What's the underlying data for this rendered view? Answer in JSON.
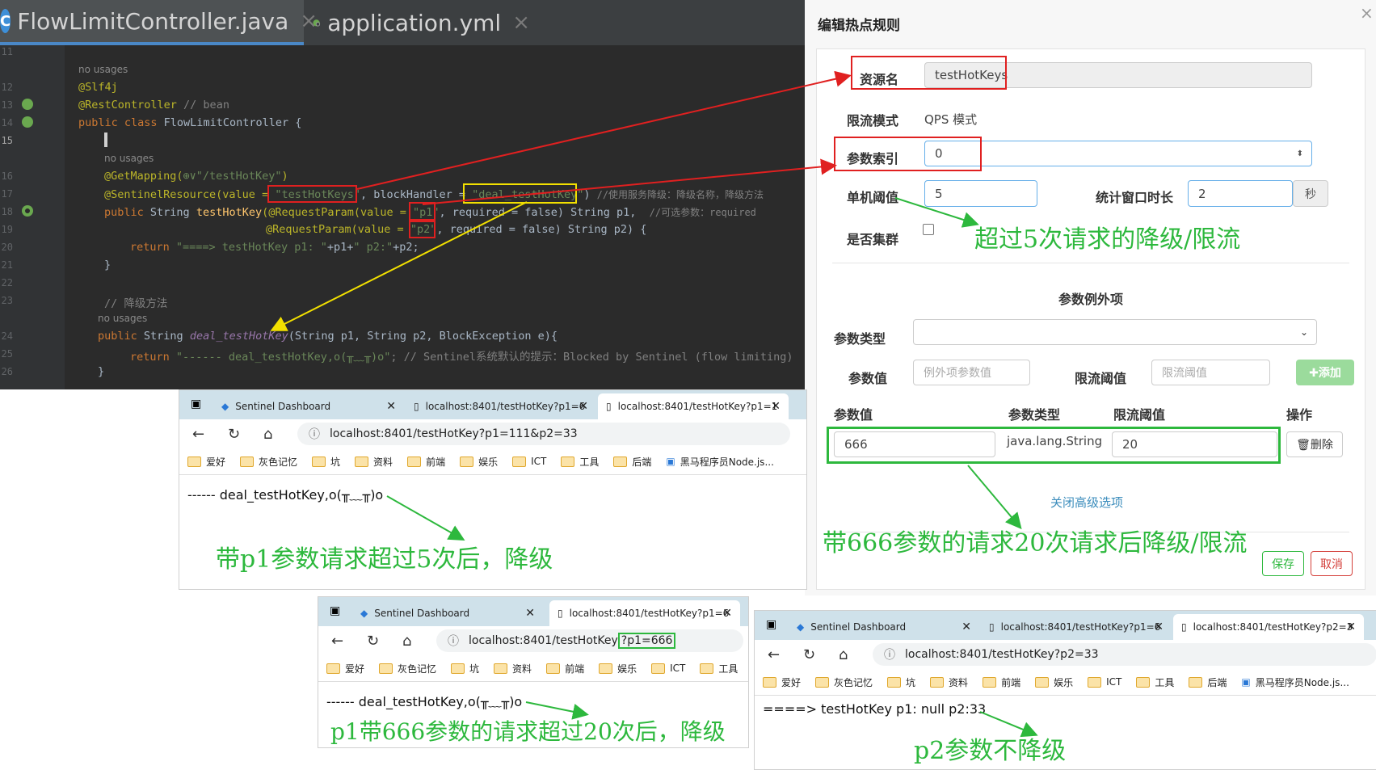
{
  "ide": {
    "tabs": [
      {
        "label": "FlowLimitController.java",
        "icon": "java-class-icon",
        "close": "×"
      },
      {
        "label": "application.yml",
        "icon": "spring-leaf-icon",
        "close": "×"
      }
    ],
    "line_numbers": [
      "11",
      "12",
      "13",
      "14",
      "15",
      "16",
      "17",
      "18",
      "19",
      "20",
      "21",
      "22",
      "23",
      "24",
      "25",
      "26"
    ],
    "hints": {
      "no_usages_1": "no usages",
      "no_usages_2": "no usages",
      "no_usages_3": "no usages"
    },
    "code": {
      "l12": "@Slf4j",
      "l13_a": "@RestController",
      "l13_b": " // bean",
      "l14_a": "public class ",
      "l14_b": "FlowLimitController {",
      "l16_a": "@GetMapping(",
      "l16_b": "⊕∨\"/testHotKey\"",
      "l16_c": ")",
      "l17_a": "@SentinelResource(value = ",
      "l17_b": "\"testHotKeys\"",
      "l17_c": ", blockHandler = ",
      "l17_d": "\"deal_testHotKey\"",
      "l17_e": ") ",
      "l17_f": "//使用服务降级：降级名称，降级方法",
      "l18_a": "public ",
      "l18_b": "String ",
      "l18_c": "testHotKey",
      "l18_d": "(@RequestParam(value = ",
      "l18_e": "\"p1\"",
      "l18_f": ", required = false) String p1,  ",
      "l18_g": "//可选参数：required",
      "l19_a": "@RequestParam(value = ",
      "l19_b": "\"p2\"",
      "l19_c": ", required = false) String p2) {",
      "l20_a": "return ",
      "l20_b": "\"====> testHotKey p1: \"",
      "l20_c": "+p1+",
      "l20_d": "\" p2:\"",
      "l20_e": "+p2;",
      "l21": "}",
      "l23": "// 降级方法",
      "l24_a": "public ",
      "l24_b": "String ",
      "l24_c": "deal_testHotKey",
      "l24_d": "(String p1, String p2, BlockException e){",
      "l25_a": "return ",
      "l25_b": "\"------ deal_testHotKey,o(╥﹏╥)o\"",
      "l25_c": "; // Sentinel系统默认的提示：Blocked by Sentinel (flow limiting)",
      "l26": "}"
    }
  },
  "dialog": {
    "title": "编辑热点规则",
    "close": "×",
    "resource_label": "资源名",
    "resource_value": "testHotKeys",
    "mode_label": "限流模式",
    "mode_value": "QPS 模式",
    "param_index_label": "参数索引",
    "param_index_value": "0",
    "threshold_label": "单机阈值",
    "threshold_value": "5",
    "window_label": "统计窗口时长",
    "window_value": "2",
    "window_unit": "秒",
    "cluster_label": "是否集群",
    "exceptions_title": "参数例外项",
    "param_type_label": "参数类型",
    "param_value_label": "参数值",
    "param_value_placeholder": "例外项参数值",
    "limit_label": "限流阈值",
    "limit_placeholder": "限流阈值",
    "add_button": "✚添加",
    "table_headers": [
      "参数值",
      "参数类型",
      "限流阈值",
      "操作"
    ],
    "row": {
      "value": "666",
      "type": "java.lang.String",
      "limit": "20",
      "delete": "🗑删除"
    },
    "close_advanced": "关闭高级选项",
    "save": "保存",
    "cancel": "取消"
  },
  "browser1": {
    "tabs": [
      "Sentinel Dashboard",
      "localhost:8401/testHotKey?p1=6",
      "localhost:8401/testHotKey?p1=1"
    ],
    "url": "localhost:8401/testHotKey?p1=111&p2=33",
    "bookmarks": [
      "爱好",
      "灰色记忆",
      "坑",
      "资料",
      "前端",
      "娱乐",
      "ICT",
      "工具",
      "后端",
      "黑马程序员Node.js..."
    ],
    "content": "------ deal_testHotKey,o(╥﹏╥)o"
  },
  "browser2": {
    "tabs": [
      "Sentinel Dashboard",
      "localhost:8401/testHotKey?p1=6"
    ],
    "url_a": "localhost:8401/testHotKey",
    "url_b": "?p1=666",
    "bookmarks": [
      "爱好",
      "灰色记忆",
      "坑",
      "资料",
      "前端",
      "娱乐",
      "ICT",
      "工具"
    ],
    "content": "------ deal_testHotKey,o(╥﹏╥)o"
  },
  "browser3": {
    "tabs": [
      "Sentinel Dashboard",
      "localhost:8401/testHotKey?p1=6",
      "localhost:8401/testHotKey?p2=3"
    ],
    "url": "localhost:8401/testHotKey?p2=33",
    "bookmarks": [
      "爱好",
      "灰色记忆",
      "坑",
      "资料",
      "前端",
      "娱乐",
      "ICT",
      "工具",
      "后端",
      "黑马程序员Node.js..."
    ],
    "content": "====> testHotKey p1: null p2:33"
  },
  "annotations": {
    "a1": "超过5次请求的降级/限流",
    "a2": "带666参数的请求20次请求后降级/限流",
    "a3": "带p1参数请求超过5次后，降级",
    "a4": "p1带666参数的请求超过20次后，降级",
    "a5": "p2参数不降级"
  },
  "colors": {
    "red": "#e02020",
    "yellow": "#f2e000",
    "green": "#2db83d",
    "blue_link": "#3c8dbc"
  }
}
